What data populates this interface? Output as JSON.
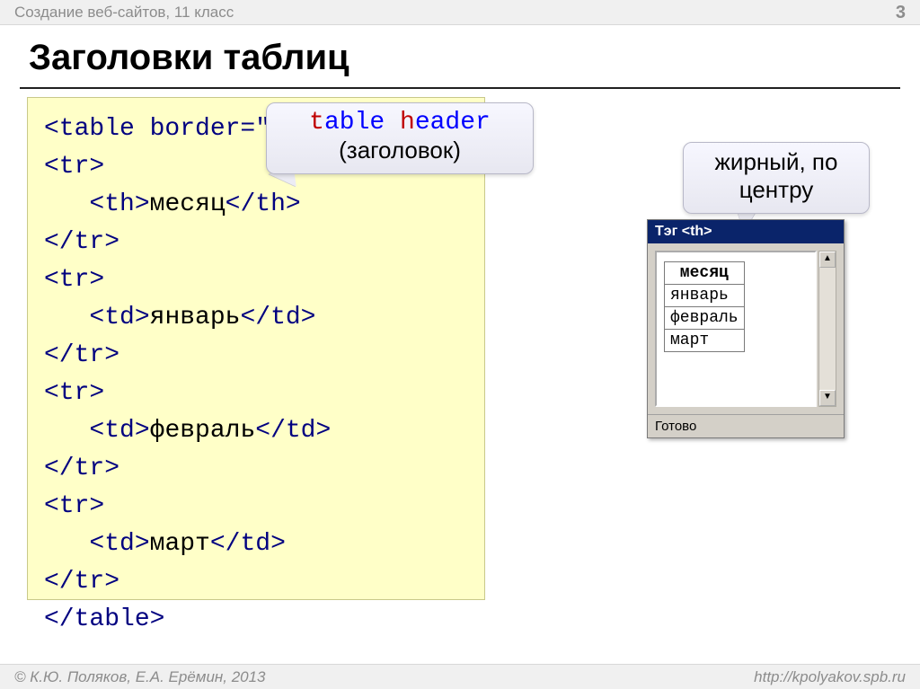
{
  "page": {
    "topbar": "Создание веб-сайтов, 11 класс",
    "number": "3",
    "title": "Заголовки таблиц",
    "footer_left": "© К.Ю. Поляков, Е.А. Ерёмин, 2013",
    "footer_right": "http://kpolyakov.spb.ru"
  },
  "code": {
    "l1a": "<table border=\"1\">",
    "l2": "<tr>",
    "l3_open": "<",
    "l3_tag": "th",
    "l3_mid": ">",
    "l3_text": "месяц",
    "l3_close_open": "</",
    "l3_close_tag": "th",
    "l3_close": ">",
    "l4": "</tr>",
    "l5": "<tr>",
    "l6_open": "<td>",
    "l6_text": "январь",
    "l6_close": "</td>",
    "l7": "</tr>",
    "l8": "<tr>",
    "l9_open": "<td>",
    "l9_text": "февраль",
    "l9_close": "</td>",
    "l10": "</tr>",
    "l11": "<tr>",
    "l12_open": "<td>",
    "l12_text": "март",
    "l12_close": "</td>",
    "l13": "</tr>",
    "l14": "</table>"
  },
  "callout1": {
    "t": "t",
    "able": "able ",
    "h": "h",
    "eader": "eader",
    "sub": "(заголовок)"
  },
  "callout2": {
    "line1": "жирный, по",
    "line2": "центру"
  },
  "miniwin": {
    "title": "Тэг <th>",
    "status": "Готово",
    "th": "месяц",
    "r1": "январь",
    "r2": "февраль",
    "r3": "март",
    "up": "▲",
    "down": "▼"
  }
}
